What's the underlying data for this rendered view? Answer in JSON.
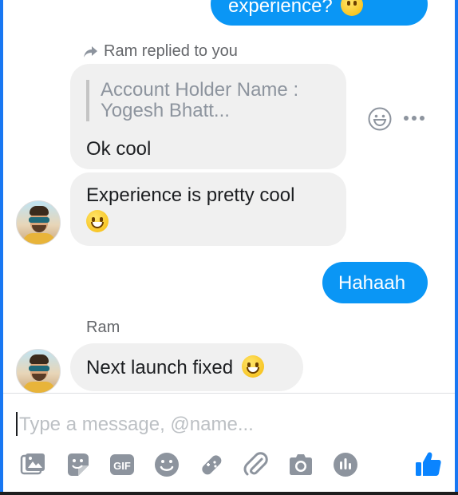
{
  "messages": {
    "sent_top": "experience?",
    "reply_header": "Ram replied to you",
    "quoted_line1": "Account Holder Name :",
    "quoted_line2": "Yogesh Bhatt...",
    "reply_text": "Ok cool",
    "incoming_1": "Experience is pretty cool",
    "sent_2": "Hahaah",
    "sender_name": "Ram",
    "incoming_2": "Next launch fixed"
  },
  "composer": {
    "placeholder": "Type a message, @name..."
  },
  "toolbar": {
    "gif_label": "GIF",
    "icons": [
      "photo-icon",
      "sticker-icon",
      "gif-icon",
      "emoji-icon",
      "game-icon",
      "attachment-icon",
      "camera-icon",
      "audio-icon",
      "like-icon"
    ]
  },
  "colors": {
    "accent": "#0a96f5",
    "incoming_bg": "#f0f0f0",
    "brand_blue": "#1877f2"
  }
}
